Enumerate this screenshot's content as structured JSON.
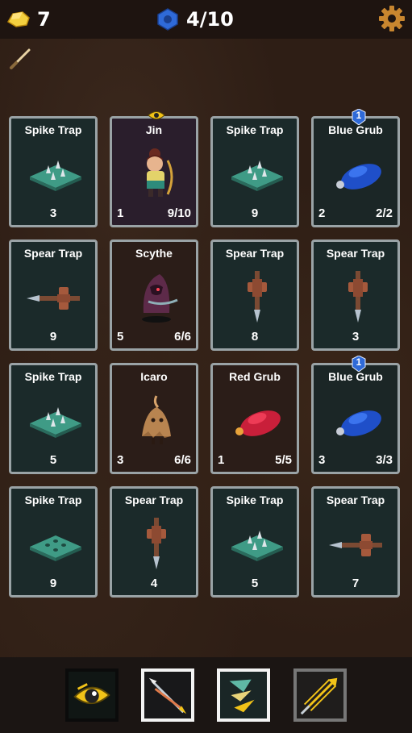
{
  "hud": {
    "gold": "7",
    "gems": "4/10"
  },
  "colors": {
    "trap_card": "#1b2a2a",
    "hero_card": "#2a1e2c",
    "monster_card": "#2b1d18",
    "border": "#9aa3a6",
    "gold_icon": "#f4d03f",
    "gem_icon": "#2f6ad8"
  },
  "cards": [
    {
      "title": "Spike Trap",
      "kind": "spike",
      "left": "",
      "center": "3",
      "right": ""
    },
    {
      "title": "Jin",
      "kind": "jin",
      "left": "1",
      "center": "",
      "right": "9/10"
    },
    {
      "title": "Spike Trap",
      "kind": "spike",
      "left": "",
      "center": "9",
      "right": ""
    },
    {
      "title": "Blue Grub",
      "kind": "bluegrub",
      "left": "2",
      "center": "",
      "right": "2/2",
      "badge": "1"
    },
    {
      "title": "Spear Trap",
      "kind": "spear-h",
      "left": "",
      "center": "9",
      "right": ""
    },
    {
      "title": "Scythe",
      "kind": "scythe",
      "left": "5",
      "center": "",
      "right": "6/6"
    },
    {
      "title": "Spear Trap",
      "kind": "spear-v",
      "left": "",
      "center": "8",
      "right": ""
    },
    {
      "title": "Spear Trap",
      "kind": "spear-v",
      "left": "",
      "center": "3",
      "right": ""
    },
    {
      "title": "Spike Trap",
      "kind": "spike",
      "left": "",
      "center": "5",
      "right": ""
    },
    {
      "title": "Icaro",
      "kind": "icaro",
      "left": "3",
      "center": "",
      "right": "6/6"
    },
    {
      "title": "Red Grub",
      "kind": "redgrub",
      "left": "1",
      "center": "",
      "right": "5/5"
    },
    {
      "title": "Blue Grub",
      "kind": "bluegrub",
      "left": "3",
      "center": "",
      "right": "3/3",
      "badge": "1"
    },
    {
      "title": "Spike Trap",
      "kind": "spike-holes",
      "left": "",
      "center": "9",
      "right": ""
    },
    {
      "title": "Spear Trap",
      "kind": "spear-v",
      "left": "",
      "center": "4",
      "right": ""
    },
    {
      "title": "Spike Trap",
      "kind": "spike",
      "left": "",
      "center": "5",
      "right": ""
    },
    {
      "title": "Spear Trap",
      "kind": "spear-h",
      "left": "",
      "center": "7",
      "right": ""
    }
  ],
  "skills": [
    "eye-skill-icon",
    "double-arrow-skill-icon",
    "blade-skill-icon",
    "triple-arrow-skill-icon"
  ]
}
